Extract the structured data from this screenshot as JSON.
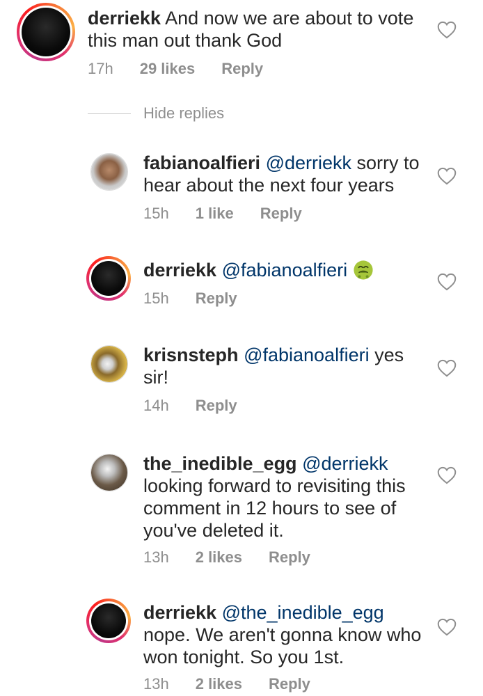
{
  "comments": [
    {
      "username": "derriekk",
      "mention": "",
      "text_lines": [
        "And now we are about to vote",
        "this man out thank God"
      ],
      "time": "17h",
      "likes": "29 likes",
      "reply": "Reply"
    },
    {
      "username": "fabianoalfieri",
      "mention": "@derriekk",
      "text_lines": [
        "sorry to",
        "hear about the next four years"
      ],
      "time": "15h",
      "likes": "1 like",
      "reply": "Reply"
    },
    {
      "username": "derriekk",
      "mention": "@fabianoalfieri",
      "emoji": "nauseated-face-emoji",
      "time": "15h",
      "likes": "",
      "reply": "Reply"
    },
    {
      "username": "krisnsteph",
      "mention": "@fabianoalfieri",
      "text_lines": [
        "yes",
        "sir!"
      ],
      "time": "14h",
      "likes": "",
      "reply": "Reply"
    },
    {
      "username": "the_inedible_egg",
      "mention": "@derriekk",
      "text_lines": [
        "looking forward to revisiting this",
        "comment in 12 hours to see of",
        "you've deleted it."
      ],
      "time": "13h",
      "likes": "2 likes",
      "reply": "Reply"
    },
    {
      "username": "derriekk",
      "mention": "@the_inedible_egg",
      "text_lines": [
        "nope. We aren't gonna know who",
        "won tonight. So you 1st."
      ],
      "time": "13h",
      "likes": "2 likes",
      "reply": "Reply"
    }
  ],
  "hide_replies_label": "Hide replies",
  "icons": {
    "like": "heart-outline-icon"
  },
  "colors": {
    "mention": "#003569",
    "meta": "#8e8e8e",
    "text": "#262626"
  }
}
